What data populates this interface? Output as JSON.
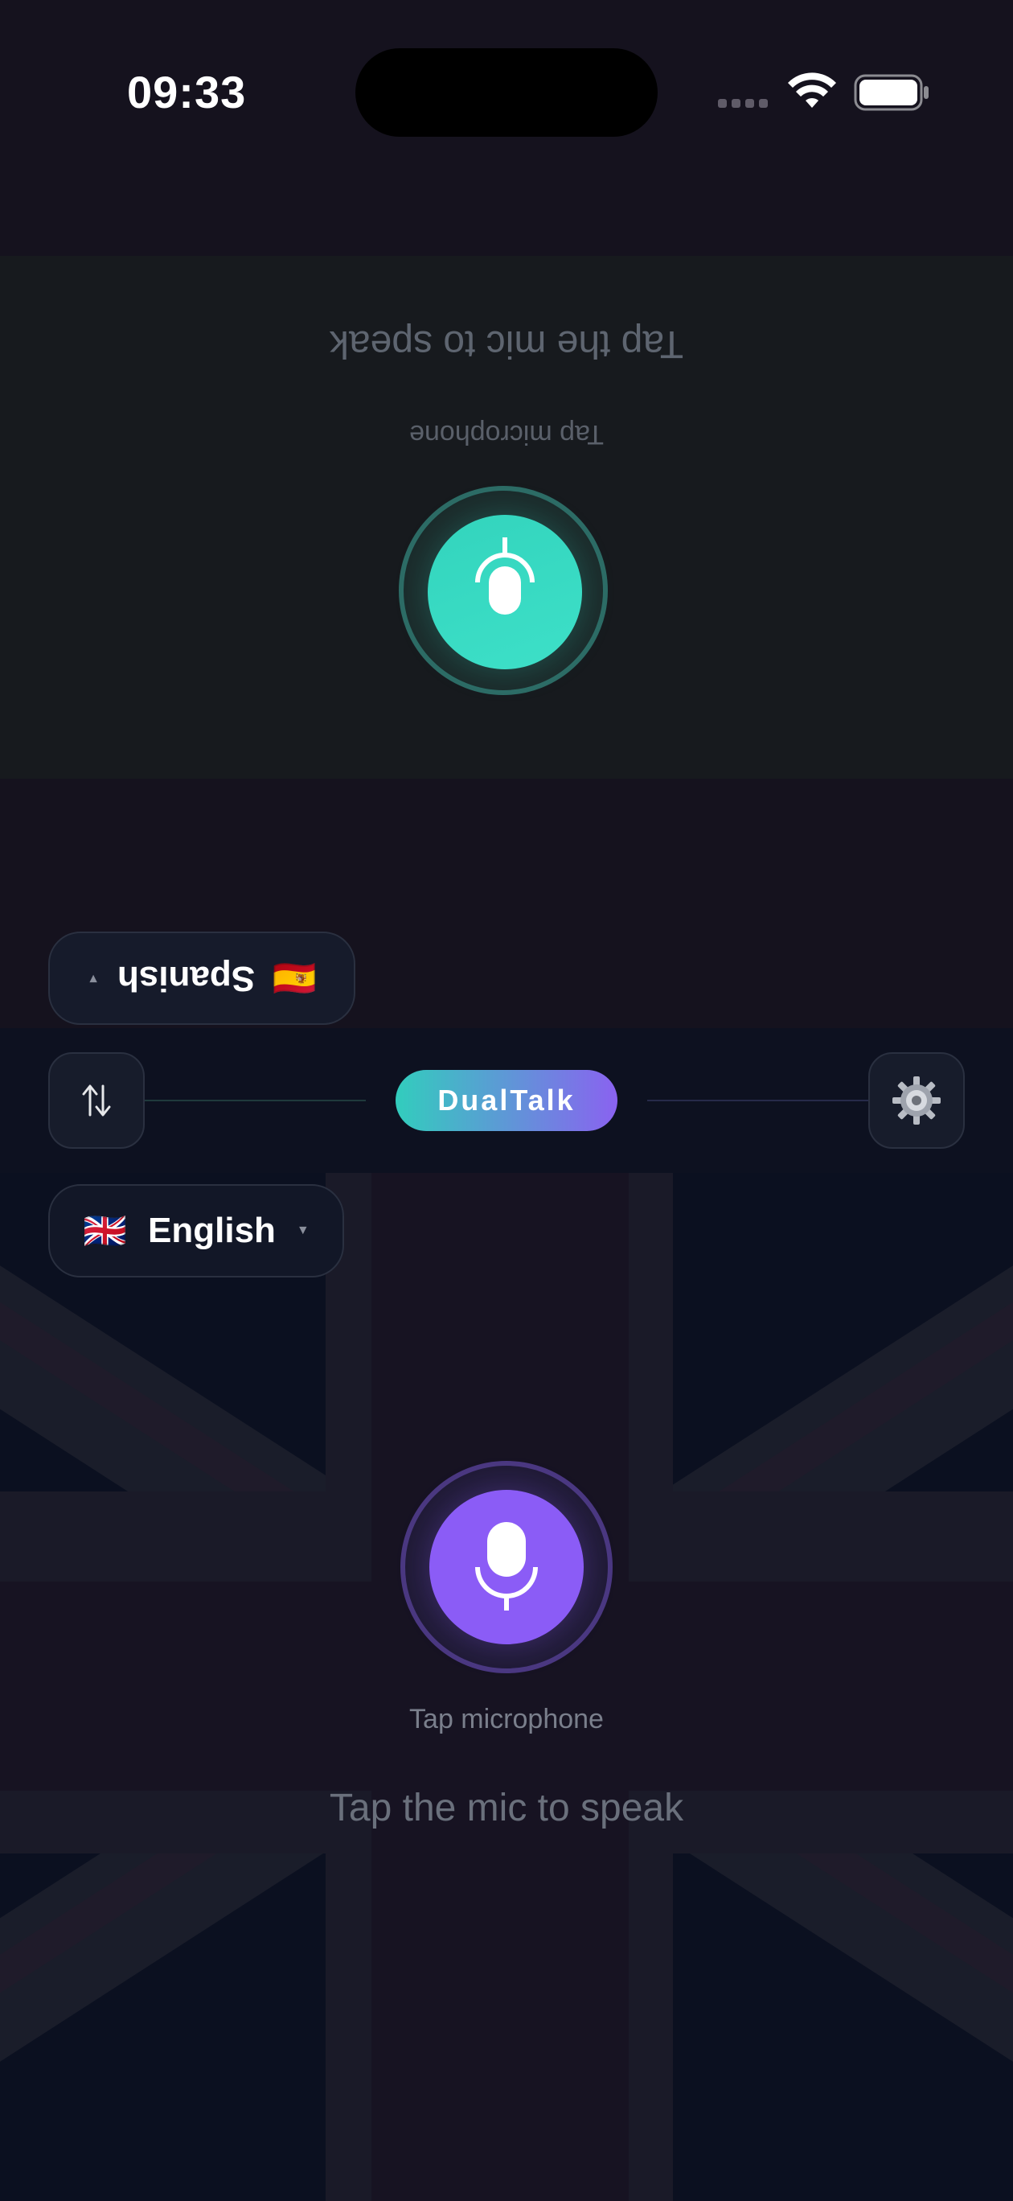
{
  "status": {
    "time": "09:33",
    "wifi_icon": "wifi-icon",
    "battery_icon": "battery-icon"
  },
  "top_panel": {
    "hint": "Tap the mic to speak",
    "subtitle": "Tap microphone",
    "mic_color": "#33d4bd"
  },
  "language_top": {
    "flag": "🇪🇸",
    "label": "Spanish"
  },
  "toolbar": {
    "brand": "DualTalk",
    "swap_icon": "swap-arrows-icon",
    "settings_icon": "gear-icon"
  },
  "language_bottom": {
    "flag": "🇬🇧",
    "label": "English"
  },
  "bottom_panel": {
    "subtitle": "Tap microphone",
    "hint": "Tap the mic to speak",
    "mic_color": "#8b5cf6"
  }
}
